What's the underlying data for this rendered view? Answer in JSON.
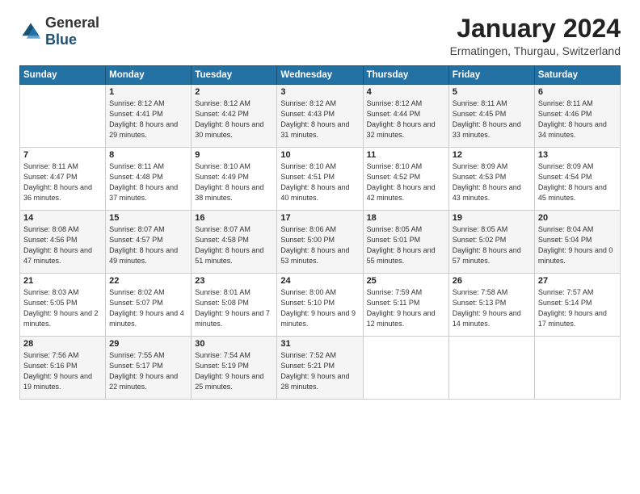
{
  "header": {
    "logo_general": "General",
    "logo_blue": "Blue",
    "month_title": "January 2024",
    "location": "Ermatingen, Thurgau, Switzerland"
  },
  "days_of_week": [
    "Sunday",
    "Monday",
    "Tuesday",
    "Wednesday",
    "Thursday",
    "Friday",
    "Saturday"
  ],
  "weeks": [
    [
      {
        "day": "",
        "sunrise": "",
        "sunset": "",
        "daylight": ""
      },
      {
        "day": "1",
        "sunrise": "Sunrise: 8:12 AM",
        "sunset": "Sunset: 4:41 PM",
        "daylight": "Daylight: 8 hours and 29 minutes."
      },
      {
        "day": "2",
        "sunrise": "Sunrise: 8:12 AM",
        "sunset": "Sunset: 4:42 PM",
        "daylight": "Daylight: 8 hours and 30 minutes."
      },
      {
        "day": "3",
        "sunrise": "Sunrise: 8:12 AM",
        "sunset": "Sunset: 4:43 PM",
        "daylight": "Daylight: 8 hours and 31 minutes."
      },
      {
        "day": "4",
        "sunrise": "Sunrise: 8:12 AM",
        "sunset": "Sunset: 4:44 PM",
        "daylight": "Daylight: 8 hours and 32 minutes."
      },
      {
        "day": "5",
        "sunrise": "Sunrise: 8:11 AM",
        "sunset": "Sunset: 4:45 PM",
        "daylight": "Daylight: 8 hours and 33 minutes."
      },
      {
        "day": "6",
        "sunrise": "Sunrise: 8:11 AM",
        "sunset": "Sunset: 4:46 PM",
        "daylight": "Daylight: 8 hours and 34 minutes."
      }
    ],
    [
      {
        "day": "7",
        "sunrise": "Sunrise: 8:11 AM",
        "sunset": "Sunset: 4:47 PM",
        "daylight": "Daylight: 8 hours and 36 minutes."
      },
      {
        "day": "8",
        "sunrise": "Sunrise: 8:11 AM",
        "sunset": "Sunset: 4:48 PM",
        "daylight": "Daylight: 8 hours and 37 minutes."
      },
      {
        "day": "9",
        "sunrise": "Sunrise: 8:10 AM",
        "sunset": "Sunset: 4:49 PM",
        "daylight": "Daylight: 8 hours and 38 minutes."
      },
      {
        "day": "10",
        "sunrise": "Sunrise: 8:10 AM",
        "sunset": "Sunset: 4:51 PM",
        "daylight": "Daylight: 8 hours and 40 minutes."
      },
      {
        "day": "11",
        "sunrise": "Sunrise: 8:10 AM",
        "sunset": "Sunset: 4:52 PM",
        "daylight": "Daylight: 8 hours and 42 minutes."
      },
      {
        "day": "12",
        "sunrise": "Sunrise: 8:09 AM",
        "sunset": "Sunset: 4:53 PM",
        "daylight": "Daylight: 8 hours and 43 minutes."
      },
      {
        "day": "13",
        "sunrise": "Sunrise: 8:09 AM",
        "sunset": "Sunset: 4:54 PM",
        "daylight": "Daylight: 8 hours and 45 minutes."
      }
    ],
    [
      {
        "day": "14",
        "sunrise": "Sunrise: 8:08 AM",
        "sunset": "Sunset: 4:56 PM",
        "daylight": "Daylight: 8 hours and 47 minutes."
      },
      {
        "day": "15",
        "sunrise": "Sunrise: 8:07 AM",
        "sunset": "Sunset: 4:57 PM",
        "daylight": "Daylight: 8 hours and 49 minutes."
      },
      {
        "day": "16",
        "sunrise": "Sunrise: 8:07 AM",
        "sunset": "Sunset: 4:58 PM",
        "daylight": "Daylight: 8 hours and 51 minutes."
      },
      {
        "day": "17",
        "sunrise": "Sunrise: 8:06 AM",
        "sunset": "Sunset: 5:00 PM",
        "daylight": "Daylight: 8 hours and 53 minutes."
      },
      {
        "day": "18",
        "sunrise": "Sunrise: 8:05 AM",
        "sunset": "Sunset: 5:01 PM",
        "daylight": "Daylight: 8 hours and 55 minutes."
      },
      {
        "day": "19",
        "sunrise": "Sunrise: 8:05 AM",
        "sunset": "Sunset: 5:02 PM",
        "daylight": "Daylight: 8 hours and 57 minutes."
      },
      {
        "day": "20",
        "sunrise": "Sunrise: 8:04 AM",
        "sunset": "Sunset: 5:04 PM",
        "daylight": "Daylight: 9 hours and 0 minutes."
      }
    ],
    [
      {
        "day": "21",
        "sunrise": "Sunrise: 8:03 AM",
        "sunset": "Sunset: 5:05 PM",
        "daylight": "Daylight: 9 hours and 2 minutes."
      },
      {
        "day": "22",
        "sunrise": "Sunrise: 8:02 AM",
        "sunset": "Sunset: 5:07 PM",
        "daylight": "Daylight: 9 hours and 4 minutes."
      },
      {
        "day": "23",
        "sunrise": "Sunrise: 8:01 AM",
        "sunset": "Sunset: 5:08 PM",
        "daylight": "Daylight: 9 hours and 7 minutes."
      },
      {
        "day": "24",
        "sunrise": "Sunrise: 8:00 AM",
        "sunset": "Sunset: 5:10 PM",
        "daylight": "Daylight: 9 hours and 9 minutes."
      },
      {
        "day": "25",
        "sunrise": "Sunrise: 7:59 AM",
        "sunset": "Sunset: 5:11 PM",
        "daylight": "Daylight: 9 hours and 12 minutes."
      },
      {
        "day": "26",
        "sunrise": "Sunrise: 7:58 AM",
        "sunset": "Sunset: 5:13 PM",
        "daylight": "Daylight: 9 hours and 14 minutes."
      },
      {
        "day": "27",
        "sunrise": "Sunrise: 7:57 AM",
        "sunset": "Sunset: 5:14 PM",
        "daylight": "Daylight: 9 hours and 17 minutes."
      }
    ],
    [
      {
        "day": "28",
        "sunrise": "Sunrise: 7:56 AM",
        "sunset": "Sunset: 5:16 PM",
        "daylight": "Daylight: 9 hours and 19 minutes."
      },
      {
        "day": "29",
        "sunrise": "Sunrise: 7:55 AM",
        "sunset": "Sunset: 5:17 PM",
        "daylight": "Daylight: 9 hours and 22 minutes."
      },
      {
        "day": "30",
        "sunrise": "Sunrise: 7:54 AM",
        "sunset": "Sunset: 5:19 PM",
        "daylight": "Daylight: 9 hours and 25 minutes."
      },
      {
        "day": "31",
        "sunrise": "Sunrise: 7:52 AM",
        "sunset": "Sunset: 5:21 PM",
        "daylight": "Daylight: 9 hours and 28 minutes."
      },
      {
        "day": "",
        "sunrise": "",
        "sunset": "",
        "daylight": ""
      },
      {
        "day": "",
        "sunrise": "",
        "sunset": "",
        "daylight": ""
      },
      {
        "day": "",
        "sunrise": "",
        "sunset": "",
        "daylight": ""
      }
    ]
  ]
}
